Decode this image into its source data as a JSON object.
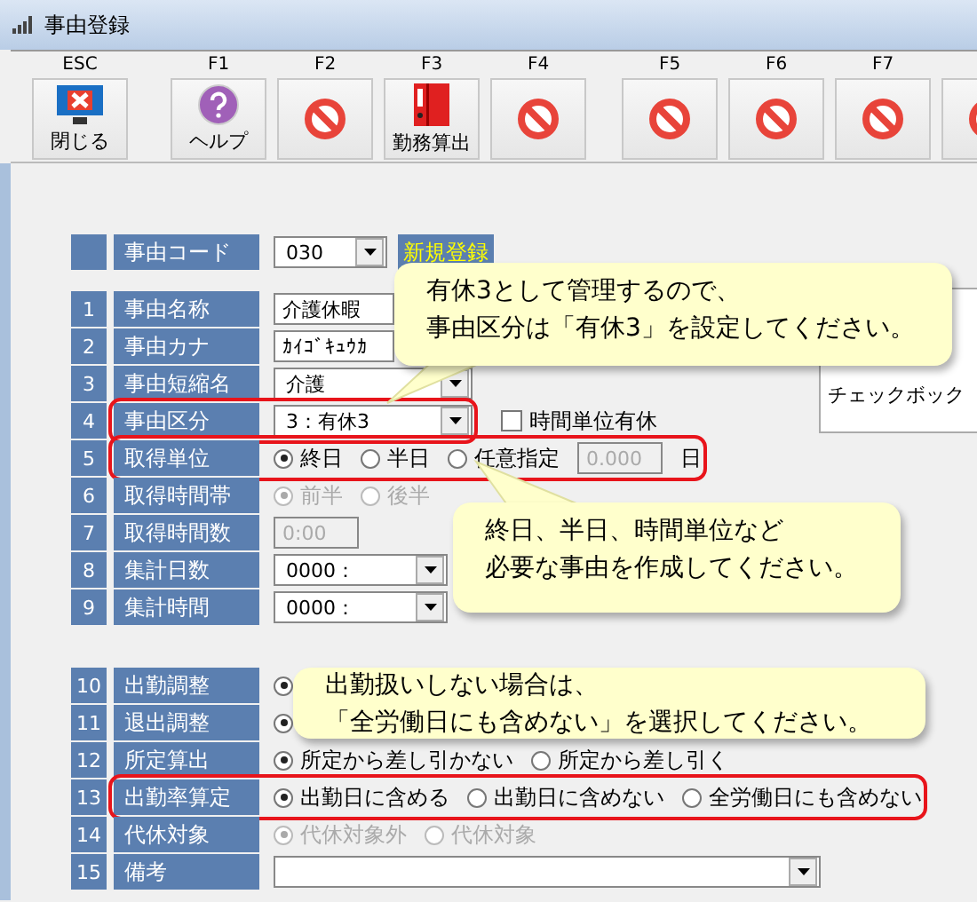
{
  "window": {
    "title": "事由登録"
  },
  "toolbar": {
    "buttons": [
      {
        "key": "ESC",
        "label": "閉じる",
        "kind": "close"
      },
      {
        "key": "F1",
        "label": "ヘルプ",
        "kind": "help"
      },
      {
        "key": "F2",
        "kind": "unavailable"
      },
      {
        "key": "F3",
        "label": "勤務算出",
        "kind": "calc"
      },
      {
        "key": "F4",
        "kind": "unavailable"
      },
      {
        "key": "F5",
        "kind": "unavailable"
      },
      {
        "key": "F6",
        "kind": "unavailable"
      },
      {
        "key": "F7",
        "kind": "unavailable"
      },
      {
        "kind": "unavailable"
      }
    ]
  },
  "code": {
    "label": "事由コード",
    "value": "030",
    "badge": "新規登録"
  },
  "rows": [
    {
      "number": "1",
      "label": "事由名称",
      "kind": "text",
      "value": "介護休暇",
      "highlighted": false
    },
    {
      "number": "2",
      "label": "事由カナ",
      "kind": "text",
      "value": "ｶｲｺﾞｷｭｳｶ",
      "highlighted": false
    },
    {
      "number": "3",
      "label": "事由短縮名",
      "kind": "combo",
      "value": "介護",
      "highlighted": false
    },
    {
      "number": "4",
      "label": "事由区分",
      "kind": "combo",
      "value": "3：有休3",
      "checkbox": {
        "label": "時間単位有休",
        "checked": false
      },
      "highlighted": true
    },
    {
      "number": "5",
      "label": "取得単位",
      "kind": "radio",
      "disabled": false,
      "options": [
        {
          "label": "終日",
          "selected": true
        },
        {
          "label": "半日",
          "selected": false
        },
        {
          "label": "任意指定",
          "selected": false
        }
      ],
      "amount": {
        "value": "0.000",
        "unit": "日"
      },
      "highlighted": true
    },
    {
      "number": "6",
      "label": "取得時間帯",
      "kind": "radio",
      "disabled": true,
      "options": [
        {
          "label": "前半",
          "selected": true
        },
        {
          "label": "後半",
          "selected": false
        }
      ],
      "highlighted": false
    },
    {
      "number": "7",
      "label": "取得時間数",
      "kind": "time",
      "value": "0:00",
      "highlighted": false
    },
    {
      "number": "8",
      "label": "集計日数",
      "kind": "combo",
      "value": "0000：",
      "highlighted": false
    },
    {
      "number": "9",
      "label": "集計時間",
      "kind": "combo",
      "value": "0000：",
      "highlighted": false
    },
    {
      "number": "10",
      "label": "出勤調整",
      "kind": "radio",
      "disabled": false,
      "options": [
        {
          "selected": true
        }
      ],
      "highlighted": false
    },
    {
      "number": "11",
      "label": "退出調整",
      "kind": "radio",
      "disabled": false,
      "options": [
        {
          "selected": true
        }
      ],
      "highlighted": false
    },
    {
      "number": "12",
      "label": "所定算出",
      "kind": "radio",
      "disabled": false,
      "options": [
        {
          "label": "所定から差し引かない",
          "selected": true
        },
        {
          "label": "所定から差し引く",
          "selected": false
        }
      ],
      "highlighted": false
    },
    {
      "number": "13",
      "label": "出勤率算定",
      "kind": "radio",
      "disabled": false,
      "options": [
        {
          "label": "出勤日に含める",
          "selected": true
        },
        {
          "label": "出勤日に含めない",
          "selected": false
        },
        {
          "label": "全労働日にも含めない",
          "selected": false
        }
      ],
      "highlighted": true
    },
    {
      "number": "14",
      "label": "代休対象",
      "kind": "radio",
      "disabled": true,
      "options": [
        {
          "label": "代休対象外",
          "selected": true
        },
        {
          "label": "代休対象",
          "selected": false
        }
      ],
      "highlighted": false
    },
    {
      "number": "15",
      "label": "備考",
      "kind": "combo",
      "value": "",
      "highlighted": false
    }
  ],
  "side_panel": {
    "text": "チェックボック"
  },
  "callouts": [
    {
      "lines": [
        "有休3として管理するので、",
        "事由区分は「有休3」を設定してください。"
      ]
    },
    {
      "lines": [
        "終日、半日、時間単位など",
        "必要な事由を作成してください。"
      ]
    },
    {
      "lines": [
        "出勤扱いしない場合は、",
        "「全労働日にも含めない」を選択してください。"
      ]
    }
  ]
}
